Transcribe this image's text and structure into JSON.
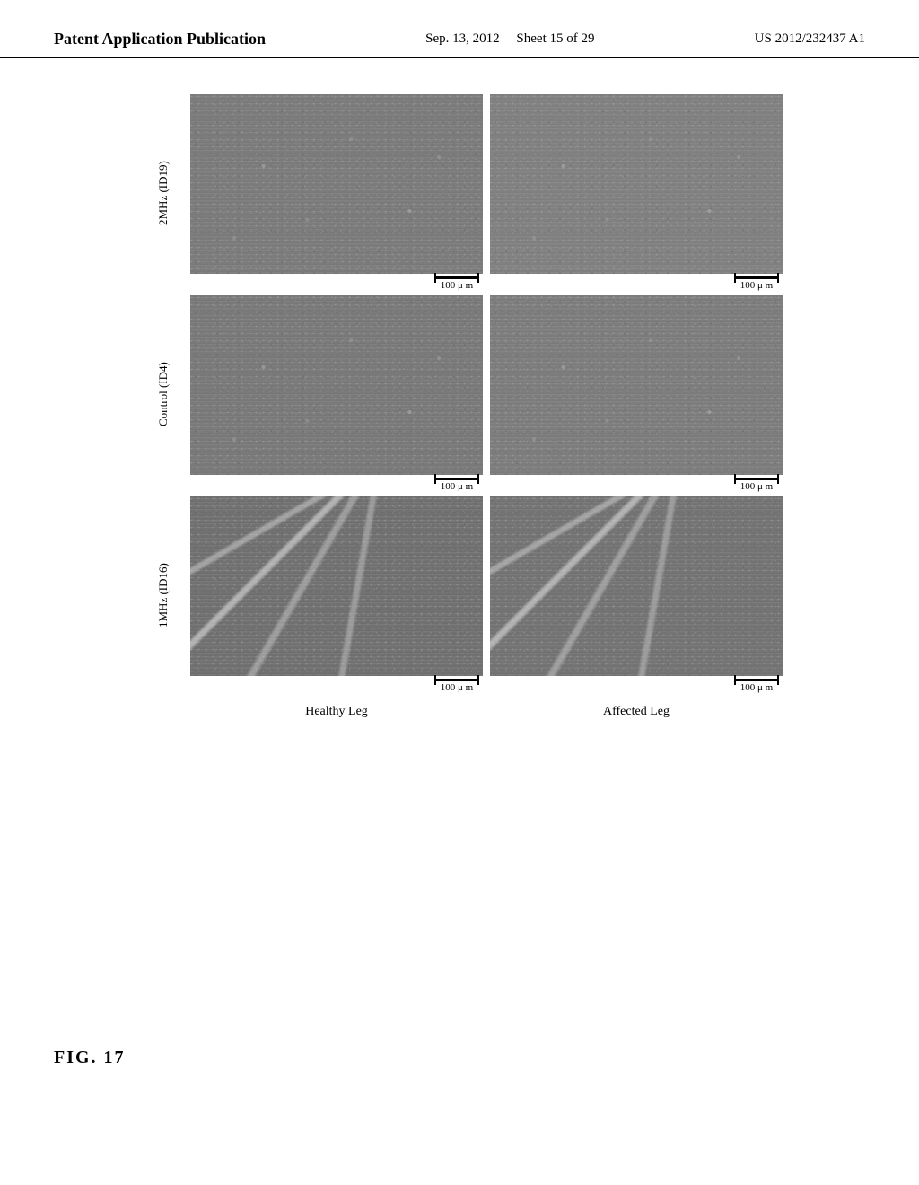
{
  "header": {
    "left": "Patent Application Publication",
    "center_date": "Sep. 13, 2012",
    "center_sheet": "Sheet 15 of 29",
    "right": "US 2012/232437 A1"
  },
  "figure": {
    "title_line1": "FIG. 17",
    "rows": [
      {
        "label": "2MHz (ID19)",
        "images": [
          {
            "scale_text": "100 μ m",
            "type": "row1-left"
          },
          {
            "scale_text": "100 μ m",
            "type": "row1-right"
          }
        ]
      },
      {
        "label": "Control (ID4)",
        "images": [
          {
            "scale_text": "100 μ m",
            "type": "row2-left"
          },
          {
            "scale_text": "100 μ m",
            "type": "row2-right"
          }
        ]
      },
      {
        "label": "1MHz (ID16)",
        "images": [
          {
            "scale_text": "100 μ m",
            "type": "row3-left"
          },
          {
            "scale_text": "100 μ m",
            "type": "row3-right"
          }
        ]
      }
    ],
    "col_labels": [
      "Healthy Leg",
      "Affected Leg"
    ]
  }
}
